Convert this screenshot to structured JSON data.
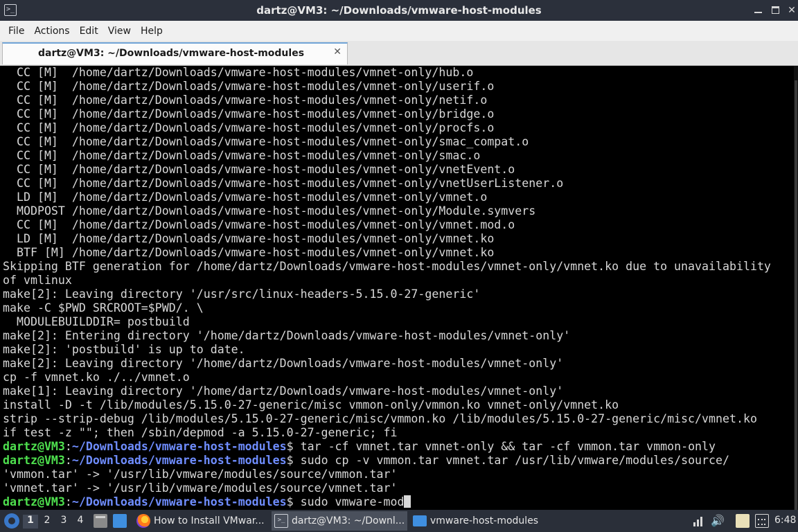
{
  "window": {
    "title": "dartz@VM3: ~/Downloads/vmware-host-modules",
    "app_icon": "terminal-icon",
    "app_icon_glyph": ">_",
    "controls": [
      "minimize-icon",
      "maximize-icon",
      "close-icon"
    ]
  },
  "menu": {
    "items": [
      "File",
      "Actions",
      "Edit",
      "View",
      "Help"
    ]
  },
  "tabs": [
    {
      "label": "dartz@VM3: ~/Downloads/vmware-host-modules",
      "close_glyph": "✕",
      "active": true
    }
  ],
  "terminal": {
    "colors": {
      "foreground": "#d8d8d8",
      "prompt_user": "#4ee04e",
      "prompt_path": "#6f8dff",
      "background": "#000000"
    },
    "lines": [
      {
        "text": "  CC [M]  /home/dartz/Downloads/vmware-host-modules/vmnet-only/hub.o"
      },
      {
        "text": "  CC [M]  /home/dartz/Downloads/vmware-host-modules/vmnet-only/userif.o"
      },
      {
        "text": "  CC [M]  /home/dartz/Downloads/vmware-host-modules/vmnet-only/netif.o"
      },
      {
        "text": "  CC [M]  /home/dartz/Downloads/vmware-host-modules/vmnet-only/bridge.o"
      },
      {
        "text": "  CC [M]  /home/dartz/Downloads/vmware-host-modules/vmnet-only/procfs.o"
      },
      {
        "text": "  CC [M]  /home/dartz/Downloads/vmware-host-modules/vmnet-only/smac_compat.o"
      },
      {
        "text": "  CC [M]  /home/dartz/Downloads/vmware-host-modules/vmnet-only/smac.o"
      },
      {
        "text": "  CC [M]  /home/dartz/Downloads/vmware-host-modules/vmnet-only/vnetEvent.o"
      },
      {
        "text": "  CC [M]  /home/dartz/Downloads/vmware-host-modules/vmnet-only/vnetUserListener.o"
      },
      {
        "text": "  LD [M]  /home/dartz/Downloads/vmware-host-modules/vmnet-only/vmnet.o"
      },
      {
        "text": "  MODPOST /home/dartz/Downloads/vmware-host-modules/vmnet-only/Module.symvers"
      },
      {
        "text": "  CC [M]  /home/dartz/Downloads/vmware-host-modules/vmnet-only/vmnet.mod.o"
      },
      {
        "text": "  LD [M]  /home/dartz/Downloads/vmware-host-modules/vmnet-only/vmnet.ko"
      },
      {
        "text": "  BTF [M] /home/dartz/Downloads/vmware-host-modules/vmnet-only/vmnet.ko"
      },
      {
        "text": "Skipping BTF generation for /home/dartz/Downloads/vmware-host-modules/vmnet-only/vmnet.ko due to unavailability"
      },
      {
        "text": "of vmlinux"
      },
      {
        "text": "make[2]: Leaving directory '/usr/src/linux-headers-5.15.0-27-generic'"
      },
      {
        "text": "make -C $PWD SRCROOT=$PWD/. \\"
      },
      {
        "text": "  MODULEBUILDDIR= postbuild"
      },
      {
        "text": "make[2]: Entering directory '/home/dartz/Downloads/vmware-host-modules/vmnet-only'"
      },
      {
        "text": "make[2]: 'postbuild' is up to date."
      },
      {
        "text": "make[2]: Leaving directory '/home/dartz/Downloads/vmware-host-modules/vmnet-only'"
      },
      {
        "text": "cp -f vmnet.ko ./../vmnet.o"
      },
      {
        "text": "make[1]: Leaving directory '/home/dartz/Downloads/vmware-host-modules/vmnet-only'"
      },
      {
        "text": "install -D -t /lib/modules/5.15.0-27-generic/misc vmmon-only/vmmon.ko vmnet-only/vmnet.ko"
      },
      {
        "text": "strip --strip-debug /lib/modules/5.15.0-27-generic/misc/vmmon.ko /lib/modules/5.15.0-27-generic/misc/vmnet.ko"
      },
      {
        "text": "if test -z \"\"; then /sbin/depmod -a 5.15.0-27-generic; fi"
      },
      {
        "prompt_user": "dartz@VM3",
        "prompt_sep": ":",
        "prompt_path": "~/Downloads/vmware-host-modules",
        "prompt_end": "$ ",
        "command": "tar -cf vmnet.tar vmnet-only && tar -cf vmmon.tar vmmon-only"
      },
      {
        "prompt_user": "dartz@VM3",
        "prompt_sep": ":",
        "prompt_path": "~/Downloads/vmware-host-modules",
        "prompt_end": "$ ",
        "command": "sudo cp -v vmmon.tar vmnet.tar /usr/lib/vmware/modules/source/"
      },
      {
        "text": "'vmmon.tar' -> '/usr/lib/vmware/modules/source/vmmon.tar'"
      },
      {
        "text": "'vmnet.tar' -> '/usr/lib/vmware/modules/source/vmnet.tar'"
      },
      {
        "prompt_user": "dartz@VM3",
        "prompt_sep": ":",
        "prompt_path": "~/Downloads/vmware-host-modules",
        "prompt_end": "$ ",
        "command": "sudo vmware-mod",
        "cursor": true
      }
    ]
  },
  "taskbar": {
    "start_icon": "start-menu-icon",
    "workspaces": [
      "1",
      "2",
      "3",
      "4"
    ],
    "active_workspace": "1",
    "quick_launch": [
      "file-manager-icon",
      "show-desktop-icon"
    ],
    "tasks": [
      {
        "label": "How to Install VMwar...",
        "icon": "firefox-icon"
      },
      {
        "label": "dartz@VM3: ~/Downl...",
        "icon": "terminal-icon",
        "icon_glyph": ">_",
        "active": true
      },
      {
        "label": "vmware-host-modules",
        "icon": "folder-icon"
      }
    ],
    "tray": [
      "network-icon",
      "volume-icon",
      "clipboard-icon",
      "keyboard-icon"
    ],
    "volume_glyph": "🔊",
    "clock": "6:48"
  }
}
